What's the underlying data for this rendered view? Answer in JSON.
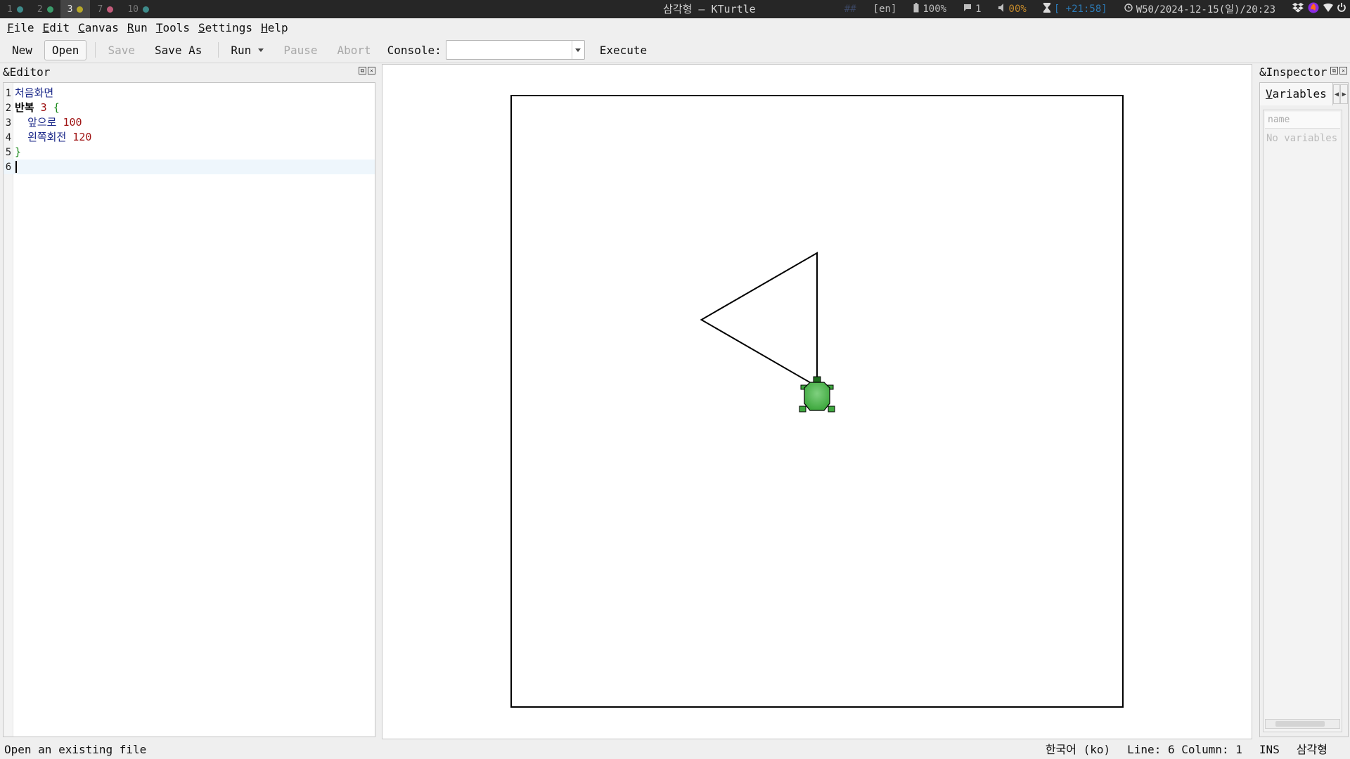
{
  "topbar": {
    "workspaces": [
      {
        "num": "1",
        "dot": "#3e8b8b",
        "active": false
      },
      {
        "num": "2",
        "dot": "#3a9a6a",
        "active": false
      },
      {
        "num": "3",
        "dot": "#b7a82a",
        "active": true
      },
      {
        "num": "7",
        "dot": "#c25b7a",
        "active": false
      },
      {
        "num": "10",
        "dot": "#3e8b8b",
        "active": false
      }
    ],
    "window_title": "삼각형 — KTurtle",
    "hash": "##",
    "lang": "[en]",
    "battery": "100%",
    "notifications": "1",
    "volume": "00%",
    "timer": "[ +21:58]",
    "datetime": "W50/2024-12-15(일)/20:23"
  },
  "menu": [
    {
      "label": "File",
      "accel": "F"
    },
    {
      "label": "Edit",
      "accel": "E"
    },
    {
      "label": "Canvas",
      "accel": "C"
    },
    {
      "label": "Run",
      "accel": "R"
    },
    {
      "label": "Tools",
      "accel": "T"
    },
    {
      "label": "Settings",
      "accel": "S"
    },
    {
      "label": "Help",
      "accel": "H"
    }
  ],
  "toolbar": {
    "new": "New",
    "open": "Open",
    "save": "Save",
    "save_as": "Save As",
    "run": "Run",
    "pause": "Pause",
    "abort": "Abort",
    "console_label": "Console:",
    "console_value": "",
    "execute": "Execute"
  },
  "editor": {
    "title": "&Editor",
    "lines": [
      {
        "n": "1",
        "parts": [
          {
            "t": "처음화면",
            "c": "kw-blue"
          }
        ]
      },
      {
        "n": "2",
        "parts": [
          {
            "t": "반복",
            "c": "kw-bold"
          },
          {
            "t": " ",
            "c": ""
          },
          {
            "t": "3",
            "c": "num"
          },
          {
            "t": " ",
            "c": ""
          },
          {
            "t": "{",
            "c": "brace"
          }
        ]
      },
      {
        "n": "3",
        "parts": [
          {
            "t": "  ",
            "c": ""
          },
          {
            "t": "앞으로",
            "c": "kw-blue"
          },
          {
            "t": " ",
            "c": ""
          },
          {
            "t": "100",
            "c": "num"
          }
        ]
      },
      {
        "n": "4",
        "parts": [
          {
            "t": "  ",
            "c": ""
          },
          {
            "t": "왼쪽회전",
            "c": "kw-blue"
          },
          {
            "t": " ",
            "c": ""
          },
          {
            "t": "120",
            "c": "num"
          }
        ]
      },
      {
        "n": "5",
        "parts": [
          {
            "t": "}",
            "c": "brace"
          }
        ]
      },
      {
        "n": "6",
        "parts": [],
        "current": true
      }
    ]
  },
  "canvas": {
    "turtle_color": "#3ea83e",
    "turtle_dark": "#1e6e1e",
    "triangle": {
      "side": 100,
      "turns": 3,
      "left_turn_deg": 120
    }
  },
  "inspector": {
    "title": "&Inspector",
    "tab": "Variables",
    "tab_accel": "V",
    "column": "name",
    "empty": "No variables"
  },
  "status": {
    "message": "Open an existing file",
    "language": "한국어 (ko)",
    "position": "Line: 6 Column: 1",
    "mode": "INS",
    "filename": "삼각형"
  }
}
